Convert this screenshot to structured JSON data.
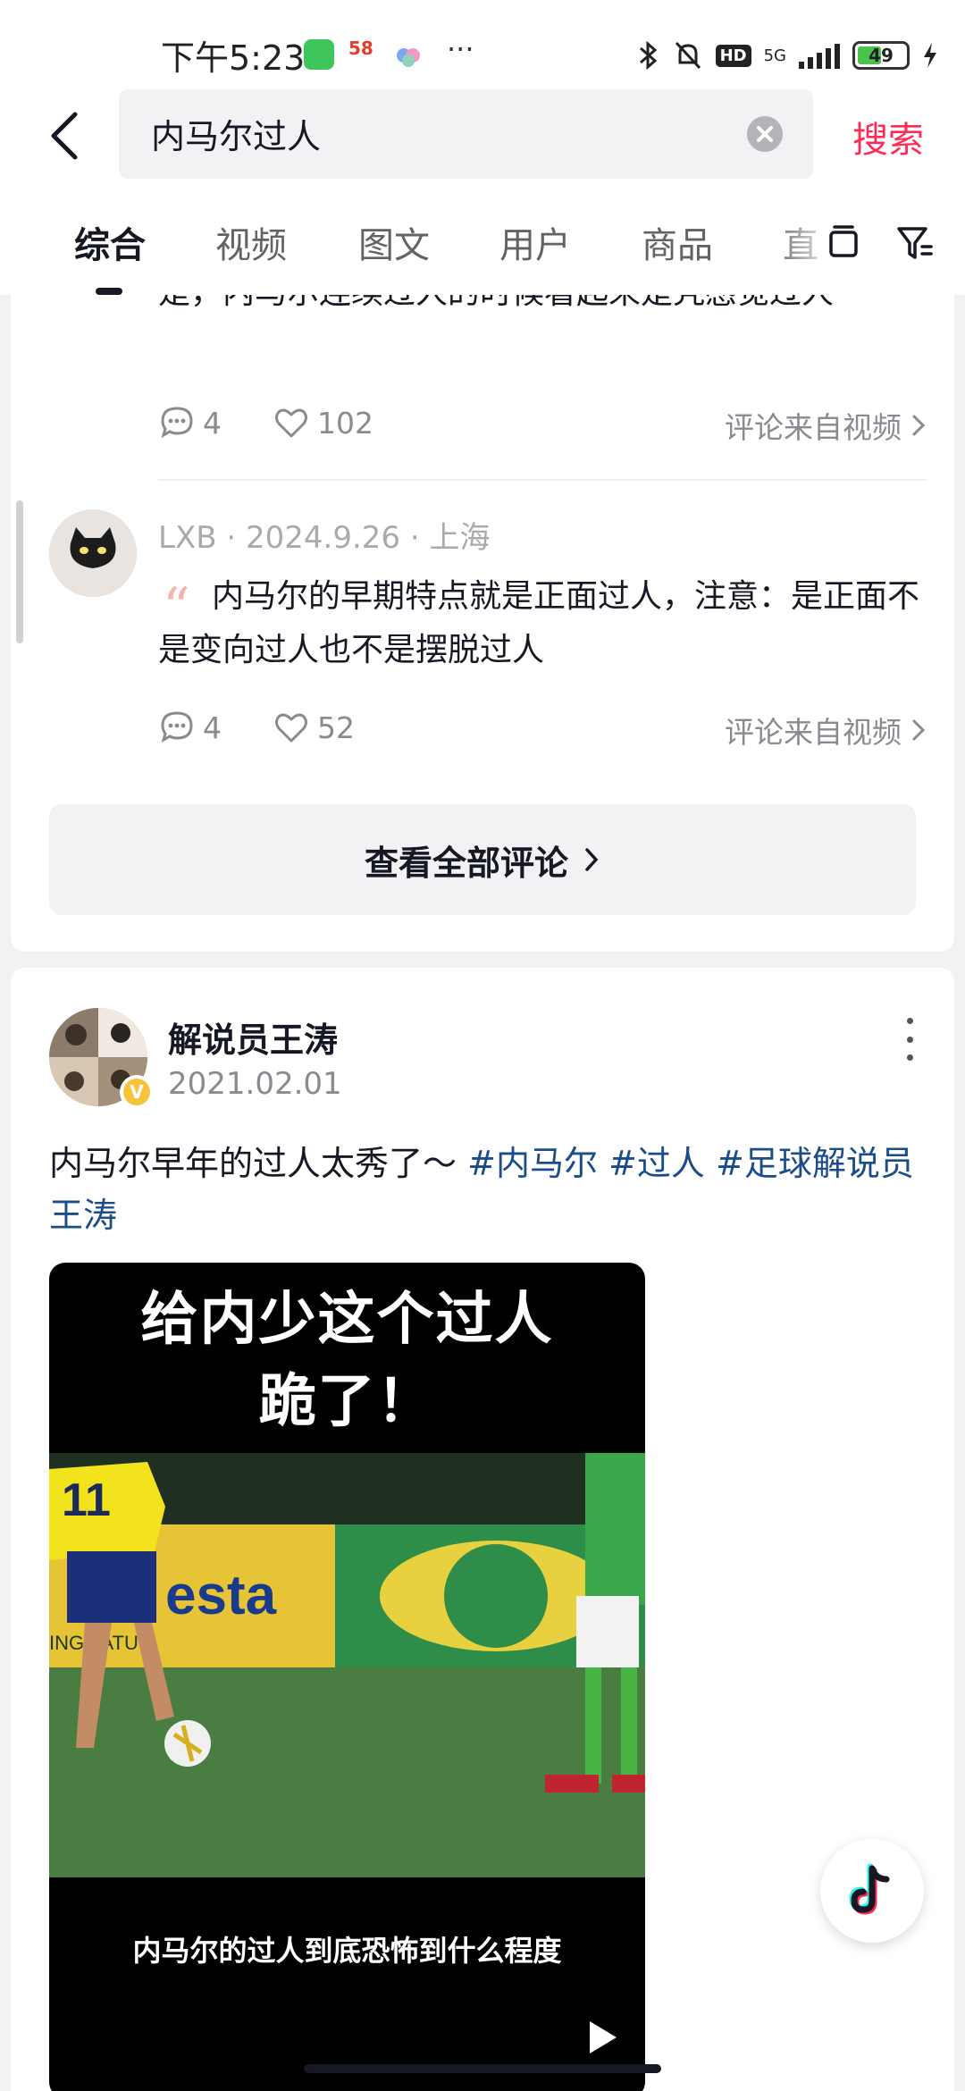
{
  "status_bar": {
    "time": "下午5:23",
    "network": "5G",
    "hd": "HD",
    "battery": "49",
    "app2_label": "58"
  },
  "search": {
    "query": "内马尔过人",
    "submit_label": "搜索"
  },
  "tabs": [
    "综合",
    "视频",
    "图文",
    "用户",
    "商品",
    "直"
  ],
  "comments": {
    "prev": {
      "text": "是，内马尔连续过人的时候看起来是凭感觉过人",
      "reply_count": "4",
      "like_count": "102",
      "source": "评论来自视频"
    },
    "current": {
      "user": "LXB",
      "date": "2024.9.26",
      "location": "上海",
      "text": "内马尔的早期特点就是正面过人，注意：是正面不是变向过人也不是摆脱过人",
      "reply_count": "4",
      "like_count": "52",
      "source": "评论来自视频"
    },
    "view_all_label": "查看全部评论"
  },
  "post": {
    "author": "解说员王涛",
    "date": "2021.02.01",
    "desc_text": "内马尔早年的过人太秀了～",
    "tags": [
      "#内马尔",
      "#过人",
      "#足球解说员王涛"
    ],
    "video": {
      "caption_line1": "给内少这个过人",
      "caption_line2": "跪了！",
      "subtitle": "内马尔的过人到底恐怖到什么程度",
      "banner_text": "esta",
      "banner_subtext": "INGA ATUI",
      "jersey_number": "11"
    }
  },
  "colors": {
    "accent": "#fe2c55",
    "hashtag": "#1b4d8a"
  }
}
